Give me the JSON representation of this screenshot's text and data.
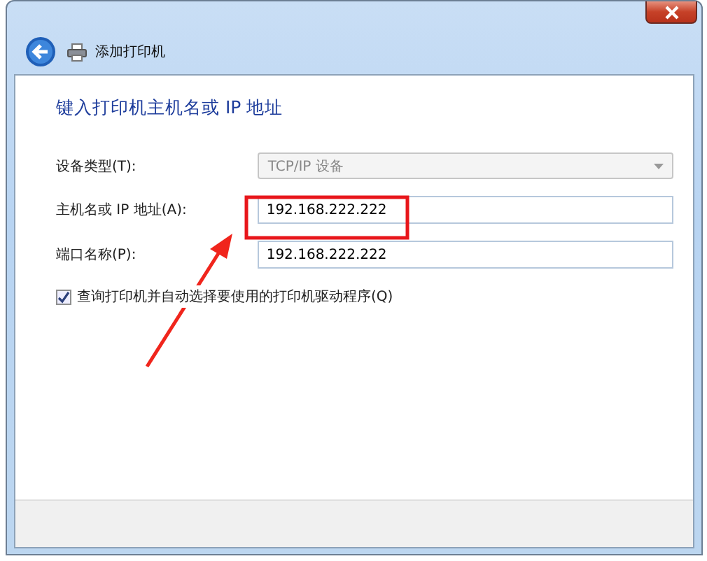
{
  "window": {
    "title": "添加打印机"
  },
  "heading": "键入打印机主机名或 IP 地址",
  "fields": [
    {
      "kind": "combo",
      "label": "设备类型(T):",
      "value": "TCP/IP 设备",
      "disabled": true
    },
    {
      "kind": "text",
      "label": "主机名或 IP 地址(A):",
      "value": "192.168.222.222",
      "disabled": false
    },
    {
      "kind": "text",
      "label": "端口名称(P):",
      "value": "192.168.222.222",
      "disabled": false
    }
  ],
  "option": {
    "label": "查询打印机并自动选择要使用的打印机驱动程序(Q)",
    "checked": true
  }
}
